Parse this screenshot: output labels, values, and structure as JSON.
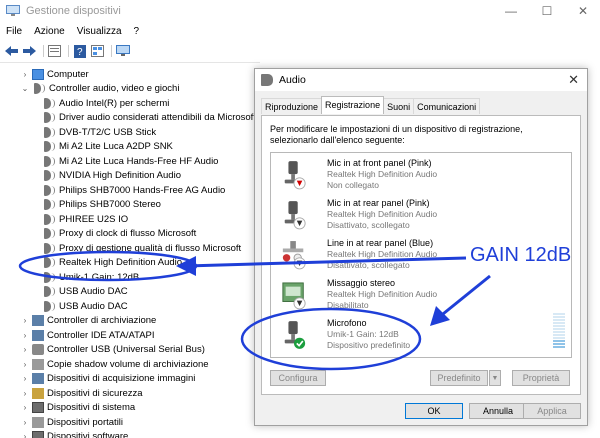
{
  "device_manager": {
    "title": "Gestione dispositivi",
    "menu": [
      "File",
      "Azione",
      "Visualizza",
      "?"
    ],
    "tree": [
      {
        "label": "Computer",
        "level": 0,
        "arrow": "right",
        "icon": "monitor-icon"
      },
      {
        "label": "Controller audio, video e giochi",
        "level": 0,
        "arrow": "down",
        "icon": "speaker-icon"
      },
      {
        "label": "Audio Intel(R) per schermi",
        "level": 1,
        "icon": "speaker-icon"
      },
      {
        "label": "Driver audio considerati attendibili da Microsoft",
        "level": 1,
        "icon": "speaker-icon"
      },
      {
        "label": "DVB-T/T2/C USB Stick",
        "level": 1,
        "icon": "speaker-icon"
      },
      {
        "label": "Mi A2 Lite Luca A2DP SNK",
        "level": 1,
        "icon": "speaker-icon"
      },
      {
        "label": "Mi A2 Lite Luca Hands-Free HF Audio",
        "level": 1,
        "icon": "speaker-icon"
      },
      {
        "label": "NVIDIA High Definition Audio",
        "level": 1,
        "icon": "speaker-icon"
      },
      {
        "label": "Philips SHB7000 Hands-Free AG Audio",
        "level": 1,
        "icon": "speaker-icon"
      },
      {
        "label": "Philips SHB7000 Stereo",
        "level": 1,
        "icon": "speaker-icon"
      },
      {
        "label": "PHIREE U2S IO",
        "level": 1,
        "icon": "speaker-icon"
      },
      {
        "label": "Proxy di clock di flusso Microsoft",
        "level": 1,
        "icon": "speaker-icon"
      },
      {
        "label": "Proxy di gestione qualità di flusso Microsoft",
        "level": 1,
        "icon": "speaker-icon"
      },
      {
        "label": "Realtek High Definition Audio",
        "level": 1,
        "icon": "speaker-icon"
      },
      {
        "label": "Umik-1  Gain: 12dB",
        "level": 1,
        "icon": "speaker-icon"
      },
      {
        "label": "USB Audio DAC",
        "level": 1,
        "icon": "speaker-icon"
      },
      {
        "label": "USB Audio DAC",
        "level": 1,
        "icon": "speaker-icon"
      },
      {
        "label": "Controller di archiviazione",
        "level": 0,
        "arrow": "right",
        "icon": "storage-controller-icon"
      },
      {
        "label": "Controller IDE ATA/ATAPI",
        "level": 0,
        "arrow": "right",
        "icon": "ide-controller-icon"
      },
      {
        "label": "Controller USB (Universal Serial Bus)",
        "level": 0,
        "arrow": "right",
        "icon": "usb-icon"
      },
      {
        "label": "Copie shadow volume di archiviazione",
        "level": 0,
        "arrow": "right",
        "icon": "disk-icon"
      },
      {
        "label": "Dispositivi di acquisizione immagini",
        "level": 0,
        "arrow": "right",
        "icon": "camera-icon"
      },
      {
        "label": "Dispositivi di sicurezza",
        "level": 0,
        "arrow": "right",
        "icon": "shield-icon"
      },
      {
        "label": "Dispositivi di sistema",
        "level": 0,
        "arrow": "right",
        "icon": "chip-icon"
      },
      {
        "label": "Dispositivi portatili",
        "level": 0,
        "arrow": "right",
        "icon": "device-icon"
      },
      {
        "label": "Dispositivi software",
        "level": 0,
        "arrow": "right",
        "icon": "chip-icon"
      }
    ]
  },
  "audio_dialog": {
    "title": "Audio",
    "tabs": [
      "Riproduzione",
      "Registrazione",
      "Suoni",
      "Comunicazioni"
    ],
    "active_tab": "Registrazione",
    "description": "Per modificare le impostazioni di un dispositivo di registrazione, selezionarlo dall'elenco seguente:",
    "devices": [
      {
        "name": "Mic in at front panel (Pink)",
        "driver": "Realtek High Definition Audio",
        "status": "Non collegato",
        "icon": "microphone-icon",
        "badge": "red-down-arrow"
      },
      {
        "name": "Mic in at rear panel (Pink)",
        "driver": "Realtek High Definition Audio",
        "status": "Disattivato, scollegato",
        "icon": "microphone-icon",
        "badge": "down-arrow"
      },
      {
        "name": "Line in at rear panel (Blue)",
        "driver": "Realtek High Definition Audio",
        "status": "Disattivato, scollegato",
        "icon": "line-in-icon",
        "badge": "down-arrow"
      },
      {
        "name": "Missaggio stereo",
        "driver": "Realtek High Definition Audio",
        "status": "Disabilitato",
        "icon": "stereo-mix-icon",
        "badge": "down-arrow"
      },
      {
        "name": "Microfono",
        "driver": "Umik-1  Gain: 12dB",
        "status": "Dispositivo predefinito",
        "icon": "microphone-icon",
        "badge": "green-check"
      }
    ],
    "buttons": {
      "configure": "Configura",
      "default": "Predefinito",
      "properties": "Proprietà",
      "ok": "OK",
      "cancel": "Annulla",
      "apply": "Applica"
    }
  },
  "annotation": {
    "label": "GAIN 12dB",
    "color": "#1f3fd8"
  }
}
